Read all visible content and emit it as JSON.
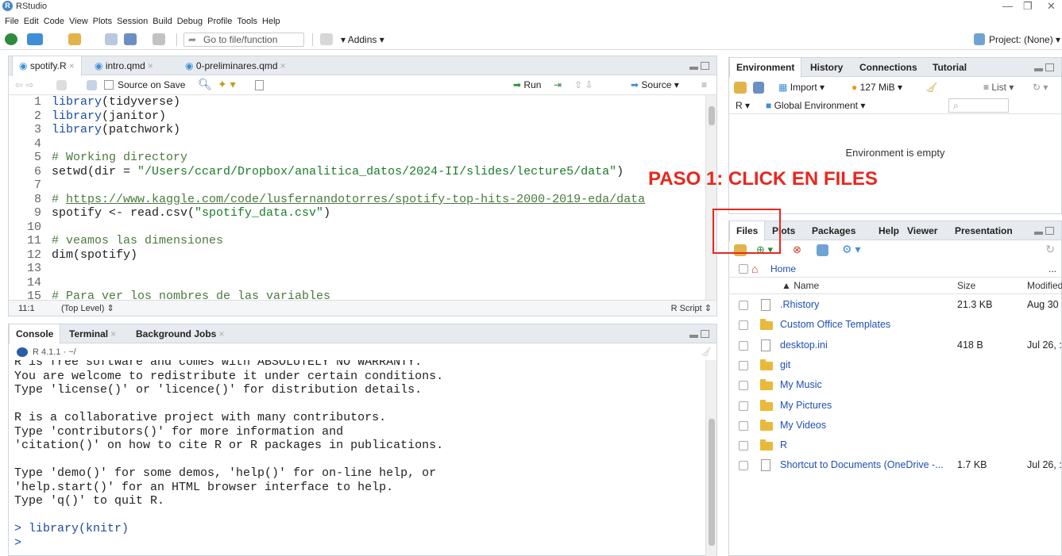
{
  "window": {
    "app_name": "RStudio",
    "minimize_glyph": "—",
    "restore_glyph": "❐",
    "close_glyph": "✕"
  },
  "menu": [
    "File",
    "Edit",
    "Code",
    "View",
    "Plots",
    "Session",
    "Build",
    "Debug",
    "Profile",
    "Tools",
    "Help"
  ],
  "toolbar": {
    "goto_placeholder": "Go to file/function",
    "addins_label": "Addins",
    "project_label": "Project: (None)"
  },
  "editor": {
    "tabs": [
      {
        "label": "spotify.R",
        "active": true
      },
      {
        "label": "intro.qmd",
        "active": false
      },
      {
        "label": "0-preliminares.qmd",
        "active": false
      }
    ],
    "source_on_save_label": "Source on Save",
    "run_label": "Run",
    "source_label": "Source",
    "status_position": "11:1",
    "status_scope": "(Top Level) ⇕",
    "status_filetype": "R Script ⇕",
    "lines": [
      {
        "n": "1",
        "segments": [
          {
            "t": "library",
            "c": "fn"
          },
          {
            "t": "(tidyverse)",
            "c": ""
          }
        ]
      },
      {
        "n": "2",
        "segments": [
          {
            "t": "library",
            "c": "fn"
          },
          {
            "t": "(janitor)",
            "c": ""
          }
        ]
      },
      {
        "n": "3",
        "segments": [
          {
            "t": "library",
            "c": "fn"
          },
          {
            "t": "(patchwork)",
            "c": ""
          }
        ]
      },
      {
        "n": "4",
        "segments": []
      },
      {
        "n": "5",
        "segments": [
          {
            "t": "# Working directory",
            "c": "cm"
          }
        ]
      },
      {
        "n": "6",
        "segments": [
          {
            "t": "setwd(dir = ",
            "c": ""
          },
          {
            "t": "\"/Users/ccard/Dropbox/analitica_datos/2024-II/slides/lecture5/data\"",
            "c": "st"
          },
          {
            "t": ")",
            "c": ""
          }
        ]
      },
      {
        "n": "7",
        "segments": []
      },
      {
        "n": "8",
        "segments": [
          {
            "t": "# ",
            "c": "cm"
          },
          {
            "t": "https://www.kaggle.com/code/lusfernandotorres/spotify-top-hits-2000-2019-eda/data",
            "c": "url"
          }
        ]
      },
      {
        "n": "9",
        "segments": [
          {
            "t": "spotify <- read.csv(",
            "c": ""
          },
          {
            "t": "\"spotify_data.csv\"",
            "c": "st"
          },
          {
            "t": ")",
            "c": ""
          }
        ]
      },
      {
        "n": "10",
        "segments": []
      },
      {
        "n": "11",
        "segments": [
          {
            "t": "# veamos las dimensiones",
            "c": "cm"
          }
        ]
      },
      {
        "n": "12",
        "segments": [
          {
            "t": "dim(spotify)",
            "c": ""
          }
        ]
      },
      {
        "n": "13",
        "segments": []
      },
      {
        "n": "14",
        "segments": []
      },
      {
        "n": "15",
        "segments": [
          {
            "t": "# Para ver los nombres de las variables",
            "c": "cm"
          }
        ]
      }
    ]
  },
  "console": {
    "tabs": [
      {
        "label": "Console",
        "active": true
      },
      {
        "label": "Terminal",
        "active": false
      },
      {
        "label": "Background Jobs",
        "active": false
      }
    ],
    "r_version": "R 4.1.1 · ~/",
    "lines": [
      "R is free software and comes with ABSOLUTELY NO WARRANTY.",
      "You are welcome to redistribute it under certain conditions.",
      "Type 'license()' or 'licence()' for distribution details.",
      "",
      "R is a collaborative project with many contributors.",
      "Type 'contributors()' for more information and",
      "'citation()' on how to cite R or R packages in publications.",
      "",
      "Type 'demo()' for some demos, 'help()' for on-line help, or",
      "'help.start()' for an HTML browser interface to help.",
      "Type 'q()' to quit R.",
      ""
    ],
    "prompt_cmd": "> library(knitr)",
    "prompt": "> "
  },
  "environment": {
    "tabs": [
      "Environment",
      "History",
      "Connections",
      "Tutorial"
    ],
    "import_label": "Import",
    "memory_label": "127 MiB",
    "list_label": "List",
    "lang_label": "R",
    "scope_label": "Global Environment",
    "empty_message": "Environment is empty"
  },
  "files": {
    "tabs": [
      "Files",
      "Plots",
      "Packages",
      "Help",
      "Viewer",
      "Presentation"
    ],
    "path_label": "Home",
    "more_label": "...",
    "col_name": "▲ Name",
    "col_size": "Size",
    "col_modified": "Modified",
    "rows": [
      {
        "name": ".Rhistory",
        "type": "file",
        "size": "21.3 KB",
        "modified": "Aug 30"
      },
      {
        "name": "Custom Office Templates",
        "type": "folder",
        "size": "",
        "modified": ""
      },
      {
        "name": "desktop.ini",
        "type": "file",
        "size": "418 B",
        "modified": "Jul 26, :"
      },
      {
        "name": "git",
        "type": "folder",
        "size": "",
        "modified": ""
      },
      {
        "name": "My Music",
        "type": "folder",
        "size": "",
        "modified": ""
      },
      {
        "name": "My Pictures",
        "type": "folder",
        "size": "",
        "modified": ""
      },
      {
        "name": "My Videos",
        "type": "folder",
        "size": "",
        "modified": ""
      },
      {
        "name": "R",
        "type": "folder",
        "size": "",
        "modified": ""
      },
      {
        "name": "Shortcut to Documents (OneDrive -...",
        "type": "file",
        "size": "1.7 KB",
        "modified": "Jul 26, :"
      }
    ]
  },
  "annotation": {
    "text": "PASO 1: CLICK EN FILES",
    "color": "#e8271e"
  }
}
